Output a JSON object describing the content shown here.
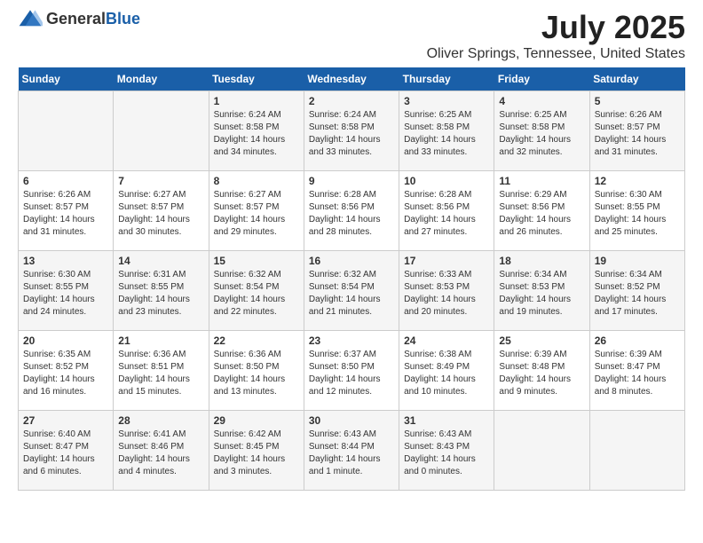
{
  "header": {
    "logo": {
      "general": "General",
      "blue": "Blue"
    },
    "title": "July 2025",
    "subtitle": "Oliver Springs, Tennessee, United States"
  },
  "calendar": {
    "weekdays": [
      "Sunday",
      "Monday",
      "Tuesday",
      "Wednesday",
      "Thursday",
      "Friday",
      "Saturday"
    ],
    "weeks": [
      [
        {
          "day": "",
          "info": ""
        },
        {
          "day": "",
          "info": ""
        },
        {
          "day": "1",
          "info": "Sunrise: 6:24 AM\nSunset: 8:58 PM\nDaylight: 14 hours\nand 34 minutes."
        },
        {
          "day": "2",
          "info": "Sunrise: 6:24 AM\nSunset: 8:58 PM\nDaylight: 14 hours\nand 33 minutes."
        },
        {
          "day": "3",
          "info": "Sunrise: 6:25 AM\nSunset: 8:58 PM\nDaylight: 14 hours\nand 33 minutes."
        },
        {
          "day": "4",
          "info": "Sunrise: 6:25 AM\nSunset: 8:58 PM\nDaylight: 14 hours\nand 32 minutes."
        },
        {
          "day": "5",
          "info": "Sunrise: 6:26 AM\nSunset: 8:57 PM\nDaylight: 14 hours\nand 31 minutes."
        }
      ],
      [
        {
          "day": "6",
          "info": "Sunrise: 6:26 AM\nSunset: 8:57 PM\nDaylight: 14 hours\nand 31 minutes."
        },
        {
          "day": "7",
          "info": "Sunrise: 6:27 AM\nSunset: 8:57 PM\nDaylight: 14 hours\nand 30 minutes."
        },
        {
          "day": "8",
          "info": "Sunrise: 6:27 AM\nSunset: 8:57 PM\nDaylight: 14 hours\nand 29 minutes."
        },
        {
          "day": "9",
          "info": "Sunrise: 6:28 AM\nSunset: 8:56 PM\nDaylight: 14 hours\nand 28 minutes."
        },
        {
          "day": "10",
          "info": "Sunrise: 6:28 AM\nSunset: 8:56 PM\nDaylight: 14 hours\nand 27 minutes."
        },
        {
          "day": "11",
          "info": "Sunrise: 6:29 AM\nSunset: 8:56 PM\nDaylight: 14 hours\nand 26 minutes."
        },
        {
          "day": "12",
          "info": "Sunrise: 6:30 AM\nSunset: 8:55 PM\nDaylight: 14 hours\nand 25 minutes."
        }
      ],
      [
        {
          "day": "13",
          "info": "Sunrise: 6:30 AM\nSunset: 8:55 PM\nDaylight: 14 hours\nand 24 minutes."
        },
        {
          "day": "14",
          "info": "Sunrise: 6:31 AM\nSunset: 8:55 PM\nDaylight: 14 hours\nand 23 minutes."
        },
        {
          "day": "15",
          "info": "Sunrise: 6:32 AM\nSunset: 8:54 PM\nDaylight: 14 hours\nand 22 minutes."
        },
        {
          "day": "16",
          "info": "Sunrise: 6:32 AM\nSunset: 8:54 PM\nDaylight: 14 hours\nand 21 minutes."
        },
        {
          "day": "17",
          "info": "Sunrise: 6:33 AM\nSunset: 8:53 PM\nDaylight: 14 hours\nand 20 minutes."
        },
        {
          "day": "18",
          "info": "Sunrise: 6:34 AM\nSunset: 8:53 PM\nDaylight: 14 hours\nand 19 minutes."
        },
        {
          "day": "19",
          "info": "Sunrise: 6:34 AM\nSunset: 8:52 PM\nDaylight: 14 hours\nand 17 minutes."
        }
      ],
      [
        {
          "day": "20",
          "info": "Sunrise: 6:35 AM\nSunset: 8:52 PM\nDaylight: 14 hours\nand 16 minutes."
        },
        {
          "day": "21",
          "info": "Sunrise: 6:36 AM\nSunset: 8:51 PM\nDaylight: 14 hours\nand 15 minutes."
        },
        {
          "day": "22",
          "info": "Sunrise: 6:36 AM\nSunset: 8:50 PM\nDaylight: 14 hours\nand 13 minutes."
        },
        {
          "day": "23",
          "info": "Sunrise: 6:37 AM\nSunset: 8:50 PM\nDaylight: 14 hours\nand 12 minutes."
        },
        {
          "day": "24",
          "info": "Sunrise: 6:38 AM\nSunset: 8:49 PM\nDaylight: 14 hours\nand 10 minutes."
        },
        {
          "day": "25",
          "info": "Sunrise: 6:39 AM\nSunset: 8:48 PM\nDaylight: 14 hours\nand 9 minutes."
        },
        {
          "day": "26",
          "info": "Sunrise: 6:39 AM\nSunset: 8:47 PM\nDaylight: 14 hours\nand 8 minutes."
        }
      ],
      [
        {
          "day": "27",
          "info": "Sunrise: 6:40 AM\nSunset: 8:47 PM\nDaylight: 14 hours\nand 6 minutes."
        },
        {
          "day": "28",
          "info": "Sunrise: 6:41 AM\nSunset: 8:46 PM\nDaylight: 14 hours\nand 4 minutes."
        },
        {
          "day": "29",
          "info": "Sunrise: 6:42 AM\nSunset: 8:45 PM\nDaylight: 14 hours\nand 3 minutes."
        },
        {
          "day": "30",
          "info": "Sunrise: 6:43 AM\nSunset: 8:44 PM\nDaylight: 14 hours\nand 1 minute."
        },
        {
          "day": "31",
          "info": "Sunrise: 6:43 AM\nSunset: 8:43 PM\nDaylight: 14 hours\nand 0 minutes."
        },
        {
          "day": "",
          "info": ""
        },
        {
          "day": "",
          "info": ""
        }
      ]
    ]
  }
}
